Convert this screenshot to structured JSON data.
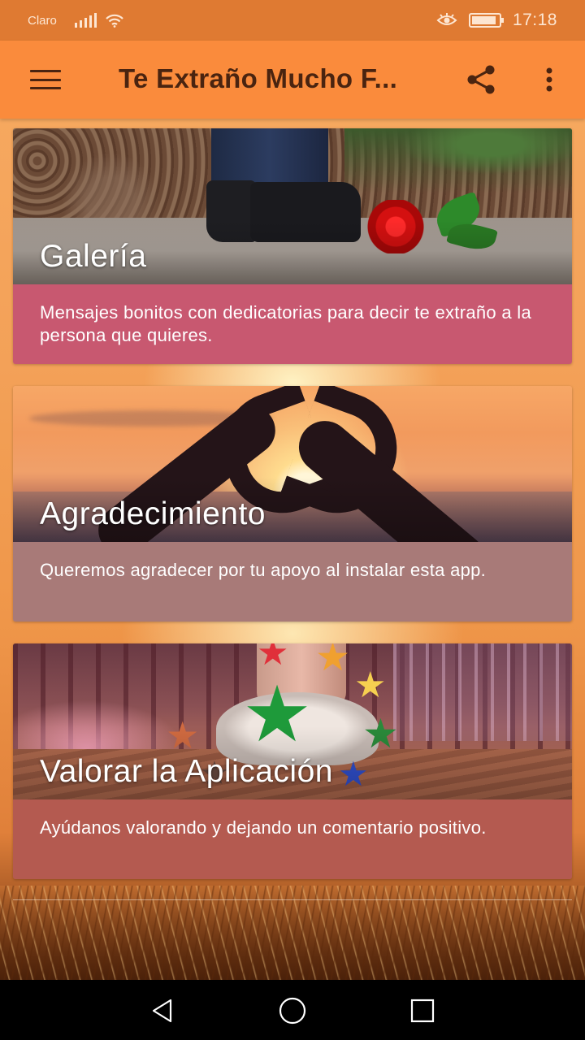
{
  "status_bar": {
    "carrier": "Claro",
    "time": "17:18",
    "battery_level": 0.9,
    "signal_icon": "signal-bars-icon",
    "wifi_icon": "wifi-icon",
    "eye_icon": "eye-comfort-icon"
  },
  "app_bar": {
    "title": "Te Extraño Mucho F...",
    "menu_icon": "hamburger-menu-icon",
    "share_icon": "share-icon",
    "more_icon": "more-vert-icon",
    "background_color": "#fa8b3c",
    "text_color": "#4a2410"
  },
  "cards": [
    {
      "title": "Galería",
      "description": "Mensajes bonitos con dedicatorias para decir te extraño a la persona que quieres.",
      "color": "#c85870"
    },
    {
      "title": "Agradecimiento",
      "description": "Queremos agradecer por tu apoyo al instalar esta app.",
      "color": "#a87a78"
    },
    {
      "title": "Valorar la Aplicación",
      "description": "Ayúdanos valorando y dejando un comentario positivo.",
      "color": "#b45a50"
    }
  ],
  "nav_bar": {
    "back_icon": "back-triangle-icon",
    "home_icon": "home-circle-icon",
    "recents_icon": "recents-square-icon"
  }
}
